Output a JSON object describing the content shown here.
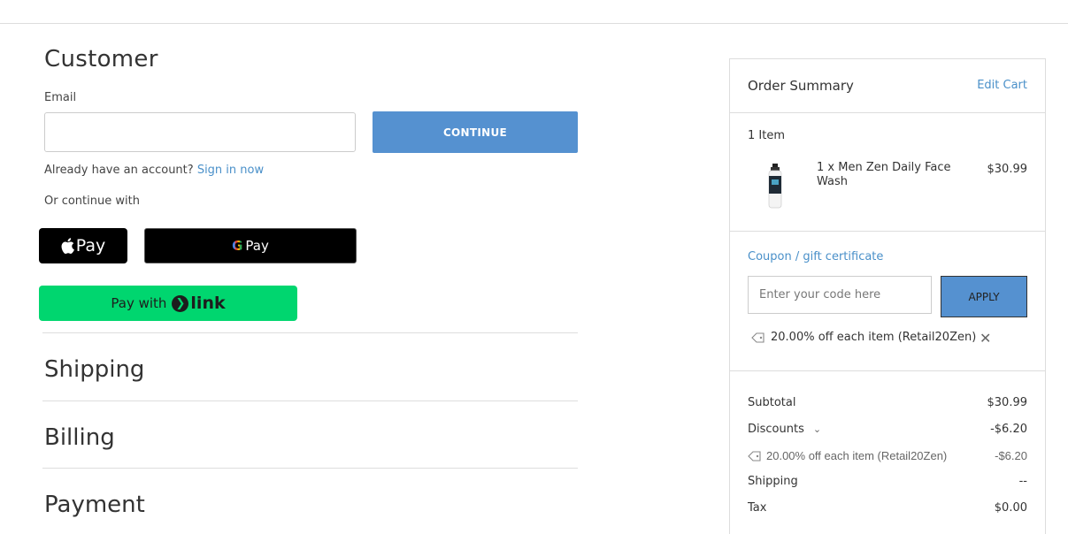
{
  "customer": {
    "title": "Customer",
    "email_label": "Email",
    "email_value": "",
    "continue_label": "CONTINUE",
    "account_prompt": "Already have an account?",
    "sign_in_label": "Sign in now",
    "or_continue": "Or continue with",
    "apple_pay_label": "Pay",
    "google_pay_g": "G",
    "google_pay_label": "Pay",
    "link_pay_prefix": "Pay with",
    "link_pay_brand": "link"
  },
  "sections": {
    "shipping": "Shipping",
    "billing": "Billing",
    "payment": "Payment"
  },
  "summary": {
    "title": "Order Summary",
    "edit_cart": "Edit Cart",
    "items_count": "1 Item",
    "product": {
      "name": "1 x Men Zen Daily Face Wash",
      "price": "$30.99"
    },
    "coupon_label": "Coupon / gift certificate",
    "coupon_placeholder": "Enter your code here",
    "apply_label": "APPLY",
    "applied_coupon": "20.00% off each item (Retail20Zen)",
    "totals": {
      "subtotal_label": "Subtotal",
      "subtotal_value": "$30.99",
      "discounts_label": "Discounts",
      "discounts_value": "-$6.20",
      "discount_detail_label": "20.00% off each item (Retail20Zen)",
      "discount_detail_value": "-$6.20",
      "shipping_label": "Shipping",
      "shipping_value": "--",
      "tax_label": "Tax",
      "tax_value": "$0.00"
    }
  },
  "colors": {
    "primary_button": "#5591d0",
    "link": "#4a90c9",
    "link_pay_green": "#00d66f"
  }
}
